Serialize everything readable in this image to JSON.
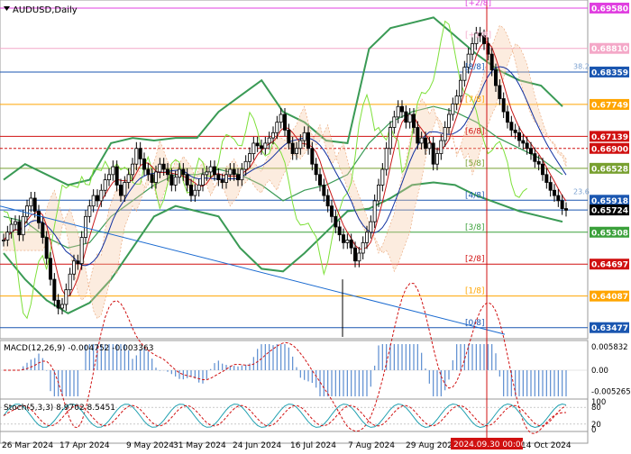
{
  "symbol_label": "AUDUSD,Daily",
  "chart_data": [
    {
      "type": "line",
      "title": "AUDUSD,Daily",
      "ylim": [
        0.633,
        0.697
      ],
      "x_labels": [
        "26 Mar 2024",
        "17 Apr 2024",
        "9 May 2024",
        "31 May 2024",
        "24 Jun 2024",
        "16 Jul 2024",
        "7 Aug 2024",
        "29 Aug 2024",
        "14 Oct 2024"
      ],
      "price_labels": [
        {
          "text": "0.69580",
          "value": 0.6958,
          "bg": "#e040e0"
        },
        {
          "text": "0.68810",
          "value": 0.6881,
          "bg": "#f4a8c8"
        },
        {
          "text": "0.68359",
          "value": 0.68359,
          "bg": "#1a56b0"
        },
        {
          "text": "0.67749",
          "value": 0.6774,
          "bg": "#ffa500"
        },
        {
          "text": "0.67139",
          "value": 0.6713,
          "bg": "#d01010"
        },
        {
          "text": "0.66900",
          "value": 0.669,
          "bg": "#d01010"
        },
        {
          "text": "0.66528",
          "value": 0.6652,
          "bg": "#78a030"
        },
        {
          "text": "0.65918",
          "value": 0.6591,
          "bg": "#1a56b0"
        },
        {
          "text": "0.65724",
          "value": 0.65724,
          "bg": "#000000"
        },
        {
          "text": "0.65308",
          "value": 0.653,
          "bg": "#3aa03a"
        },
        {
          "text": "0.64697",
          "value": 0.6469,
          "bg": "#d01010"
        },
        {
          "text": "0.64087",
          "value": 0.6408,
          "bg": "#ffa500"
        },
        {
          "text": "0.63477",
          "value": 0.63477,
          "bg": "#1a56b0"
        }
      ],
      "murrey_labels": [
        {
          "text": "[+2/8]",
          "value": 0.6958
        },
        {
          "text": "[+1/8]",
          "value": 0.6897
        },
        {
          "text": "[8/8]",
          "value": 0.6836
        },
        {
          "text": "[7/8]",
          "value": 0.6774
        },
        {
          "text": "[6/8]",
          "value": 0.6713
        },
        {
          "text": "[5/8]",
          "value": 0.6652
        },
        {
          "text": "[4/8]",
          "value": 0.6591
        },
        {
          "text": "[3/8]",
          "value": 0.653
        },
        {
          "text": "[2/8]",
          "value": 0.6469
        },
        {
          "text": "[1/8]",
          "value": 0.6408
        },
        {
          "text": "[0/8]",
          "value": 0.6347
        }
      ],
      "grid_ticks": [
        "0.69320",
        "0.69090",
        "0.68620",
        "0.68160",
        "0.67700",
        "0.67240",
        "0.66780",
        "0.66320",
        "0.65860",
        "0.65400",
        "0.65220",
        "0.64740",
        "0.64490",
        "0.64020",
        "0.63540"
      ],
      "fib_labels": [
        "38.2",
        "23.6"
      ],
      "series": [
        {
          "name": "close",
          "values": [
            0.6515,
            0.653,
            0.6545,
            0.655,
            0.6525,
            0.656,
            0.658,
            0.6595,
            0.657,
            0.6548,
            0.652,
            0.648,
            0.644,
            0.64,
            0.6385,
            0.6392,
            0.642,
            0.645,
            0.6475,
            0.647,
            0.652,
            0.656,
            0.658,
            0.66,
            0.659,
            0.661,
            0.663,
            0.664,
            0.6655,
            0.662,
            0.66,
            0.6625,
            0.664,
            0.666,
            0.669,
            0.667,
            0.665,
            0.664,
            0.6625,
            0.6645,
            0.666,
            0.665,
            0.664,
            0.662,
            0.6635,
            0.665,
            0.664,
            0.662,
            0.66,
            0.661,
            0.662,
            0.664,
            0.6645,
            0.6655,
            0.664,
            0.663,
            0.6625,
            0.664,
            0.665,
            0.664,
            0.663,
            0.665,
            0.6665,
            0.668,
            0.67,
            0.6695,
            0.669,
            0.67,
            0.671,
            0.672,
            0.674,
            0.6755,
            0.6725,
            0.67,
            0.668,
            0.669,
            0.6705,
            0.672,
            0.669,
            0.666,
            0.664,
            0.662,
            0.66,
            0.658,
            0.656,
            0.654,
            0.6525,
            0.651,
            0.6515,
            0.65,
            0.6475,
            0.649,
            0.651,
            0.653,
            0.655,
            0.659,
            0.662,
            0.665,
            0.669,
            0.673,
            0.675,
            0.677,
            0.676,
            0.674,
            0.6755,
            0.673,
            0.67,
            0.671,
            0.669,
            0.67,
            0.666,
            0.668,
            0.6705,
            0.673,
            0.6755,
            0.6775,
            0.679,
            0.682,
            0.6845,
            0.687,
            0.689,
            0.691,
            0.6905,
            0.689,
            0.687,
            0.684,
            0.681,
            0.6785,
            0.676,
            0.674,
            0.6725,
            0.672,
            0.6705,
            0.67,
            0.669,
            0.668,
            0.6665,
            0.666,
            0.664,
            0.6625,
            0.661,
            0.66,
            0.659,
            0.6575,
            0.6572
          ]
        },
        {
          "name": "upper_band",
          "values": [
            0.663,
            0.666,
            0.664,
            0.662,
            0.663,
            0.67,
            0.671,
            0.6705,
            0.671,
            0.671,
            0.676,
            0.679,
            0.682,
            0.676,
            0.674,
            0.6705,
            0.67,
            0.688,
            0.692,
            0.693,
            0.694,
            0.6905,
            0.687,
            0.684,
            0.682,
            0.681,
            0.677
          ]
        },
        {
          "name": "lower_band",
          "values": [
            0.649,
            0.644,
            0.64,
            0.6375,
            0.6395,
            0.644,
            0.65,
            0.656,
            0.658,
            0.657,
            0.656,
            0.65,
            0.646,
            0.6455,
            0.649,
            0.653,
            0.657,
            0.6575,
            0.6595,
            0.662,
            0.6625,
            0.662,
            0.66,
            0.6585,
            0.657,
            0.656,
            0.655
          ]
        },
        {
          "name": "middle_band",
          "values": [
            0.656,
            0.655,
            0.652,
            0.65,
            0.651,
            0.656,
            0.659,
            0.662,
            0.664,
            0.664,
            0.665,
            0.664,
            0.662,
            0.659,
            0.661,
            0.662,
            0.664,
            0.67,
            0.674,
            0.676,
            0.677,
            0.676,
            0.674,
            0.671,
            0.669,
            0.667,
            0.664
          ]
        }
      ]
    },
    {
      "type": "bar",
      "title": "MACD(12,26,9) -0.004752 -0.003363",
      "ylim": [
        -0.0065,
        0.0065
      ],
      "y_ticks": [
        "0.005832",
        "0.00",
        "-0.005265"
      ]
    },
    {
      "type": "line",
      "title": "Stoch(5,3,3) 8.9702 8.5451",
      "ylim": [
        0,
        100
      ],
      "y_ticks": [
        "100",
        "80",
        "20",
        "0"
      ]
    }
  ],
  "marker_date": "2024.09.30 00:00"
}
